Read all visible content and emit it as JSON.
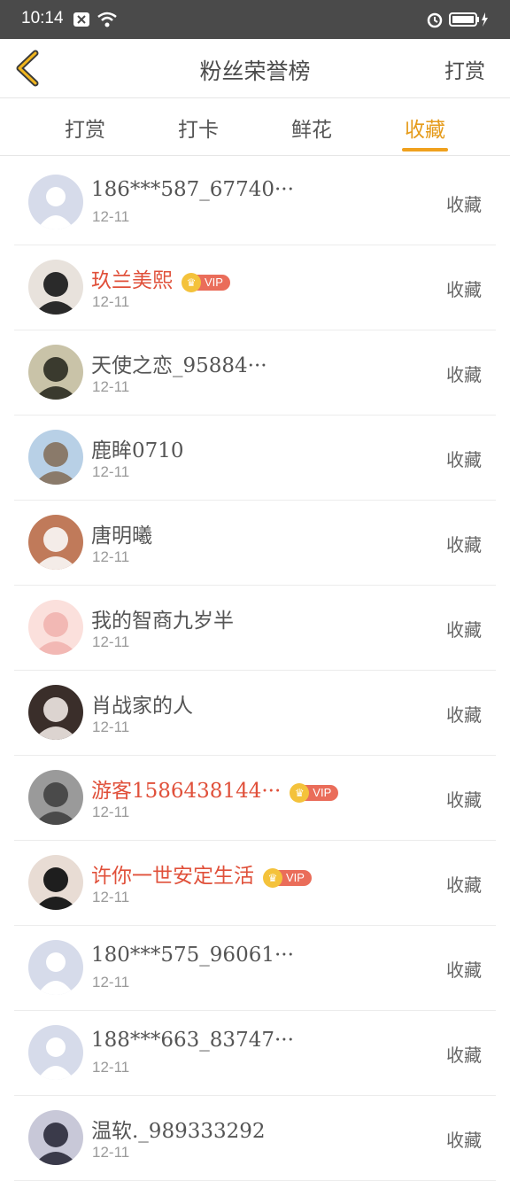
{
  "status_bar": {
    "time": "10:14"
  },
  "header": {
    "title": "粉丝荣誉榜",
    "right_label": "打赏"
  },
  "tabs": [
    {
      "label": "打赏",
      "active": false
    },
    {
      "label": "打卡",
      "active": false
    },
    {
      "label": "鲜花",
      "active": false
    },
    {
      "label": "收藏",
      "active": true
    }
  ],
  "colors": {
    "accent": "#f0a11e",
    "vip_name": "#e0503a",
    "vip_tag": "#ea6d5a"
  },
  "rows": [
    {
      "name": "186***587_67740···",
      "date": "12-11",
      "action": "收藏",
      "vip": false,
      "avatar": "default"
    },
    {
      "name": "玖兰美熙",
      "date": "12-11",
      "action": "收藏",
      "vip": true,
      "vip_label": "VIP",
      "avatar": "photo"
    },
    {
      "name": "天使之恋_95884···",
      "date": "12-11",
      "action": "收藏",
      "vip": false,
      "avatar": "photo"
    },
    {
      "name": "鹿眸0710",
      "date": "12-11",
      "action": "收藏",
      "vip": false,
      "avatar": "photo"
    },
    {
      "name": "唐明曦",
      "date": "12-11",
      "action": "收藏",
      "vip": false,
      "avatar": "photo"
    },
    {
      "name": "我的智商九岁半",
      "date": "12-11",
      "action": "收藏",
      "vip": false,
      "avatar": "photo"
    },
    {
      "name": "肖战家的人",
      "date": "12-11",
      "action": "收藏",
      "vip": false,
      "avatar": "photo"
    },
    {
      "name": "游客1586438144···",
      "date": "12-11",
      "action": "收藏",
      "vip": true,
      "vip_label": "VIP",
      "avatar": "photo"
    },
    {
      "name": "许你一世安定生活",
      "date": "12-11",
      "action": "收藏",
      "vip": true,
      "vip_label": "VIP",
      "avatar": "photo"
    },
    {
      "name": "180***575_96061···",
      "date": "12-11",
      "action": "收藏",
      "vip": false,
      "avatar": "default"
    },
    {
      "name": "188***663_83747···",
      "date": "12-11",
      "action": "收藏",
      "vip": false,
      "avatar": "default"
    },
    {
      "name": "温软._989333292",
      "date": "12-11",
      "action": "收藏",
      "vip": false,
      "avatar": "photo"
    }
  ]
}
